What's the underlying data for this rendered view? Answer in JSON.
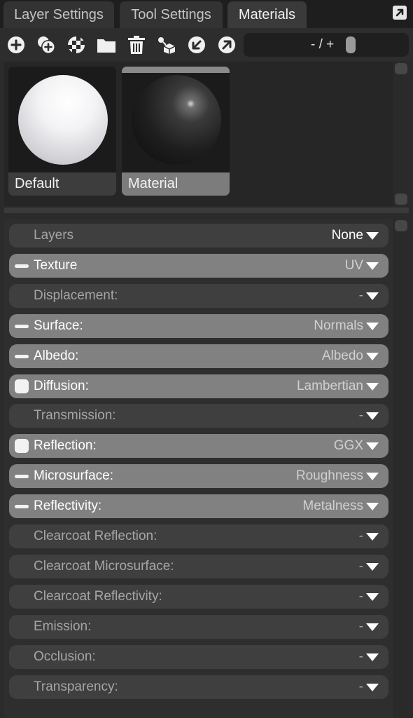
{
  "tabs": [
    {
      "label": "Layer Settings"
    },
    {
      "label": "Tool Settings"
    },
    {
      "label": "Materials"
    }
  ],
  "toolbar": {
    "zoom_label": "- / +"
  },
  "materials": [
    {
      "label": "Default",
      "selected": false
    },
    {
      "label": "Material",
      "selected": true
    }
  ],
  "properties": [
    {
      "name": "Layers",
      "value": "None",
      "enabled": false,
      "toggle": "none"
    },
    {
      "name": "Texture",
      "value": "UV",
      "enabled": true,
      "toggle": "dash"
    },
    {
      "name": "Displacement:",
      "value": "-",
      "enabled": false,
      "toggle": "none"
    },
    {
      "name": "Surface:",
      "value": "Normals",
      "enabled": true,
      "toggle": "dash"
    },
    {
      "name": "Albedo:",
      "value": "Albedo",
      "enabled": true,
      "toggle": "dash"
    },
    {
      "name": "Diffusion:",
      "value": "Lambertian",
      "enabled": true,
      "toggle": "box"
    },
    {
      "name": "Transmission:",
      "value": "-",
      "enabled": false,
      "toggle": "none"
    },
    {
      "name": "Reflection:",
      "value": "GGX",
      "enabled": true,
      "toggle": "box"
    },
    {
      "name": "Microsurface:",
      "value": "Roughness",
      "enabled": true,
      "toggle": "dash"
    },
    {
      "name": "Reflectivity:",
      "value": "Metalness",
      "enabled": true,
      "toggle": "dash"
    },
    {
      "name": "Clearcoat Reflection:",
      "value": "-",
      "enabled": false,
      "toggle": "none"
    },
    {
      "name": "Clearcoat Microsurface:",
      "value": "-",
      "enabled": false,
      "toggle": "none"
    },
    {
      "name": "Clearcoat Reflectivity:",
      "value": "-",
      "enabled": false,
      "toggle": "none"
    },
    {
      "name": "Emission:",
      "value": "-",
      "enabled": false,
      "toggle": "none"
    },
    {
      "name": "Occlusion:",
      "value": "-",
      "enabled": false,
      "toggle": "none"
    },
    {
      "name": "Transparency:",
      "value": "-",
      "enabled": false,
      "toggle": "none"
    }
  ],
  "icons": {
    "toolbar": [
      "add-material-icon",
      "duplicate-material-icon",
      "checker-icon",
      "folder-icon",
      "trash-icon",
      "assign-to-object-icon",
      "import-icon",
      "export-icon"
    ],
    "tab_bar": "popout-icon"
  },
  "colors": {
    "active_row": "#818181",
    "inactive_row": "#3f3f3f",
    "background": "#2b2b2b",
    "selected_thumbnail_label": "#7c7c7c"
  }
}
